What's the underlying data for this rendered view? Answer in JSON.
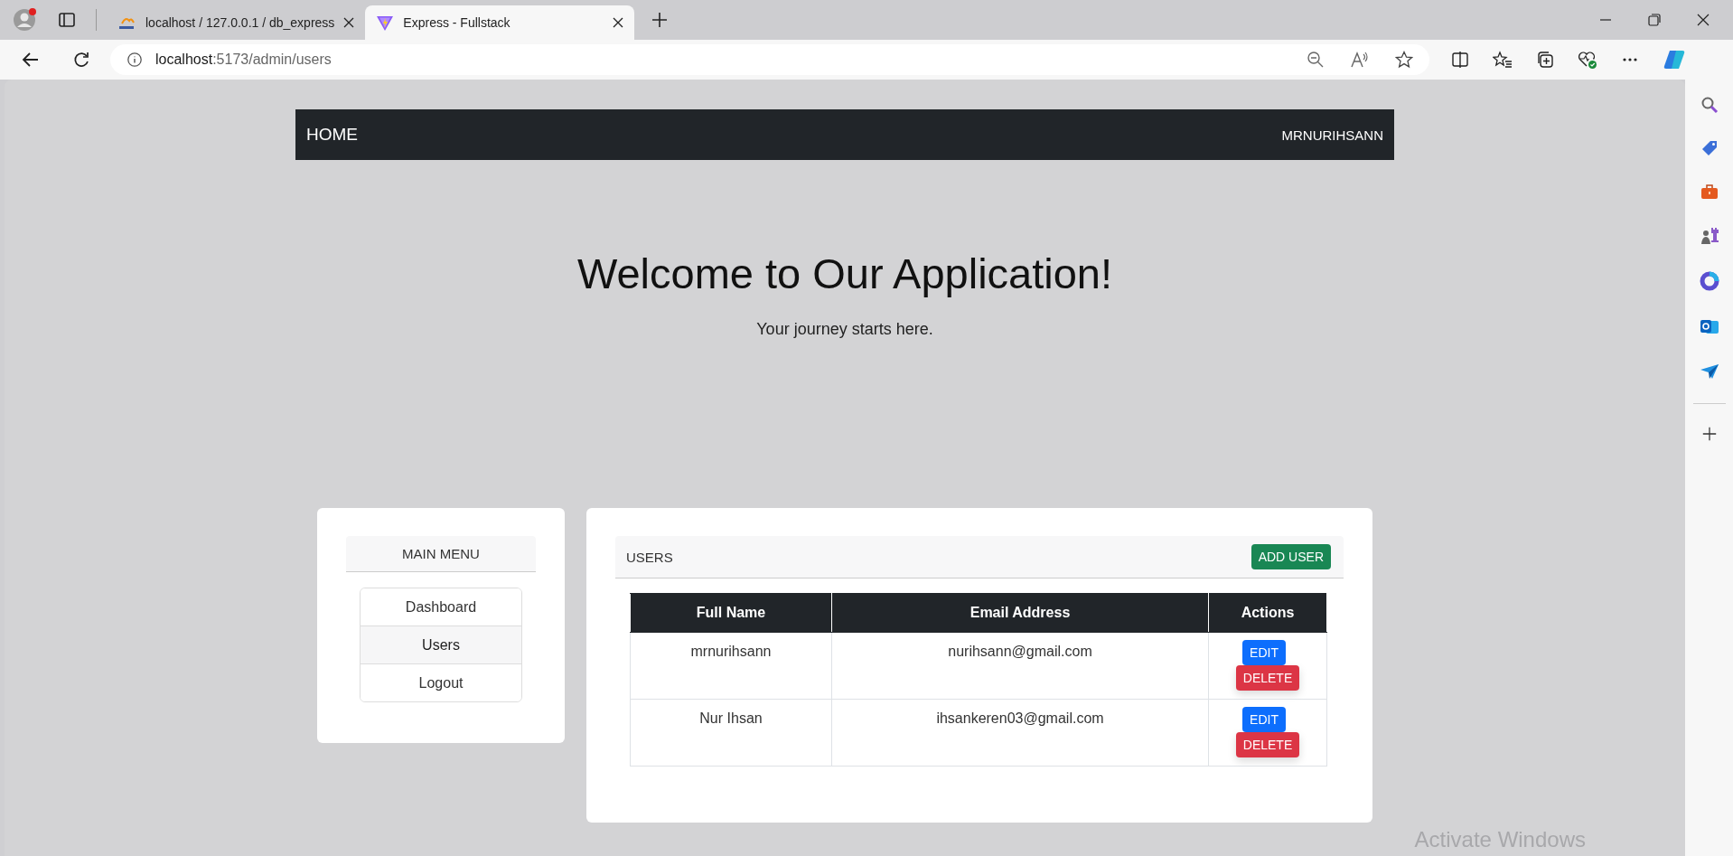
{
  "browser": {
    "tabs": [
      {
        "title": "localhost / 127.0.0.1 / db_express",
        "kind": "pma",
        "selected": false
      },
      {
        "title": "Express - Fullstack",
        "kind": "vite",
        "selected": true
      }
    ],
    "address": {
      "host": "localhost",
      "rest": ":5173/admin/users"
    }
  },
  "navbar": {
    "brand": "HOME",
    "user": "MRNURIHSANN"
  },
  "hero": {
    "title": "Welcome to Our Application!",
    "subtitle": "Your journey starts here."
  },
  "menu": {
    "title": "MAIN MENU",
    "items": [
      {
        "label": "Dashboard",
        "selected": false
      },
      {
        "label": "Users",
        "selected": true
      },
      {
        "label": "Logout",
        "selected": false
      }
    ]
  },
  "users": {
    "title": "USERS",
    "add_button": "ADD USER",
    "columns": [
      "Full Name",
      "Email Address",
      "Actions"
    ],
    "rows": [
      {
        "full_name": "mrnurihsann",
        "email": "nurihsann@gmail.com",
        "edit": "EDIT",
        "delete": "DELETE"
      },
      {
        "full_name": "Nur Ihsan",
        "email": "ihsankeren03@gmail.com",
        "edit": "EDIT",
        "delete": "DELETE"
      }
    ]
  },
  "os_notice": "Activate Windows"
}
